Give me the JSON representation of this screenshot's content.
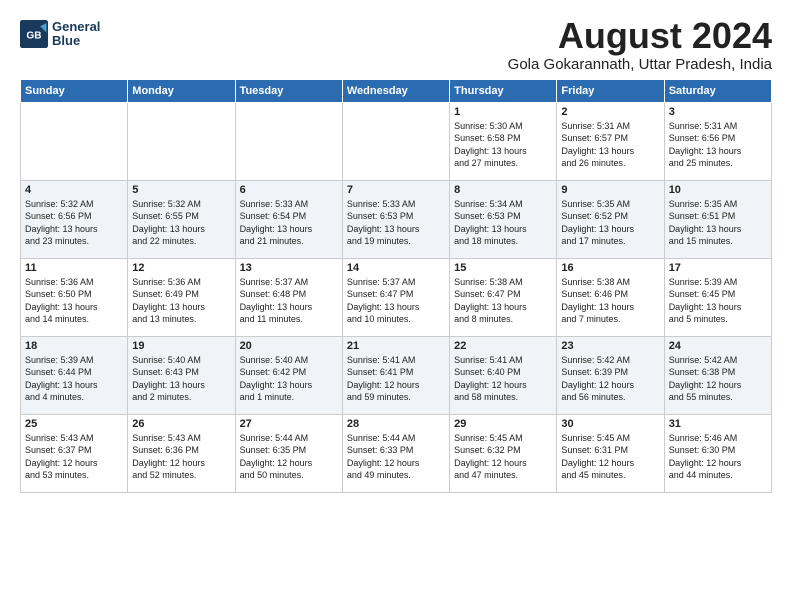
{
  "header": {
    "logo_line1": "General",
    "logo_line2": "Blue",
    "month_title": "August 2024",
    "location": "Gola Gokarannath, Uttar Pradesh, India"
  },
  "weekdays": [
    "Sunday",
    "Monday",
    "Tuesday",
    "Wednesday",
    "Thursday",
    "Friday",
    "Saturday"
  ],
  "weeks": [
    [
      {
        "day": "",
        "info": ""
      },
      {
        "day": "",
        "info": ""
      },
      {
        "day": "",
        "info": ""
      },
      {
        "day": "",
        "info": ""
      },
      {
        "day": "1",
        "info": "Sunrise: 5:30 AM\nSunset: 6:58 PM\nDaylight: 13 hours\nand 27 minutes."
      },
      {
        "day": "2",
        "info": "Sunrise: 5:31 AM\nSunset: 6:57 PM\nDaylight: 13 hours\nand 26 minutes."
      },
      {
        "day": "3",
        "info": "Sunrise: 5:31 AM\nSunset: 6:56 PM\nDaylight: 13 hours\nand 25 minutes."
      }
    ],
    [
      {
        "day": "4",
        "info": "Sunrise: 5:32 AM\nSunset: 6:56 PM\nDaylight: 13 hours\nand 23 minutes."
      },
      {
        "day": "5",
        "info": "Sunrise: 5:32 AM\nSunset: 6:55 PM\nDaylight: 13 hours\nand 22 minutes."
      },
      {
        "day": "6",
        "info": "Sunrise: 5:33 AM\nSunset: 6:54 PM\nDaylight: 13 hours\nand 21 minutes."
      },
      {
        "day": "7",
        "info": "Sunrise: 5:33 AM\nSunset: 6:53 PM\nDaylight: 13 hours\nand 19 minutes."
      },
      {
        "day": "8",
        "info": "Sunrise: 5:34 AM\nSunset: 6:53 PM\nDaylight: 13 hours\nand 18 minutes."
      },
      {
        "day": "9",
        "info": "Sunrise: 5:35 AM\nSunset: 6:52 PM\nDaylight: 13 hours\nand 17 minutes."
      },
      {
        "day": "10",
        "info": "Sunrise: 5:35 AM\nSunset: 6:51 PM\nDaylight: 13 hours\nand 15 minutes."
      }
    ],
    [
      {
        "day": "11",
        "info": "Sunrise: 5:36 AM\nSunset: 6:50 PM\nDaylight: 13 hours\nand 14 minutes."
      },
      {
        "day": "12",
        "info": "Sunrise: 5:36 AM\nSunset: 6:49 PM\nDaylight: 13 hours\nand 13 minutes."
      },
      {
        "day": "13",
        "info": "Sunrise: 5:37 AM\nSunset: 6:48 PM\nDaylight: 13 hours\nand 11 minutes."
      },
      {
        "day": "14",
        "info": "Sunrise: 5:37 AM\nSunset: 6:47 PM\nDaylight: 13 hours\nand 10 minutes."
      },
      {
        "day": "15",
        "info": "Sunrise: 5:38 AM\nSunset: 6:47 PM\nDaylight: 13 hours\nand 8 minutes."
      },
      {
        "day": "16",
        "info": "Sunrise: 5:38 AM\nSunset: 6:46 PM\nDaylight: 13 hours\nand 7 minutes."
      },
      {
        "day": "17",
        "info": "Sunrise: 5:39 AM\nSunset: 6:45 PM\nDaylight: 13 hours\nand 5 minutes."
      }
    ],
    [
      {
        "day": "18",
        "info": "Sunrise: 5:39 AM\nSunset: 6:44 PM\nDaylight: 13 hours\nand 4 minutes."
      },
      {
        "day": "19",
        "info": "Sunrise: 5:40 AM\nSunset: 6:43 PM\nDaylight: 13 hours\nand 2 minutes."
      },
      {
        "day": "20",
        "info": "Sunrise: 5:40 AM\nSunset: 6:42 PM\nDaylight: 13 hours\nand 1 minute."
      },
      {
        "day": "21",
        "info": "Sunrise: 5:41 AM\nSunset: 6:41 PM\nDaylight: 12 hours\nand 59 minutes."
      },
      {
        "day": "22",
        "info": "Sunrise: 5:41 AM\nSunset: 6:40 PM\nDaylight: 12 hours\nand 58 minutes."
      },
      {
        "day": "23",
        "info": "Sunrise: 5:42 AM\nSunset: 6:39 PM\nDaylight: 12 hours\nand 56 minutes."
      },
      {
        "day": "24",
        "info": "Sunrise: 5:42 AM\nSunset: 6:38 PM\nDaylight: 12 hours\nand 55 minutes."
      }
    ],
    [
      {
        "day": "25",
        "info": "Sunrise: 5:43 AM\nSunset: 6:37 PM\nDaylight: 12 hours\nand 53 minutes."
      },
      {
        "day": "26",
        "info": "Sunrise: 5:43 AM\nSunset: 6:36 PM\nDaylight: 12 hours\nand 52 minutes."
      },
      {
        "day": "27",
        "info": "Sunrise: 5:44 AM\nSunset: 6:35 PM\nDaylight: 12 hours\nand 50 minutes."
      },
      {
        "day": "28",
        "info": "Sunrise: 5:44 AM\nSunset: 6:33 PM\nDaylight: 12 hours\nand 49 minutes."
      },
      {
        "day": "29",
        "info": "Sunrise: 5:45 AM\nSunset: 6:32 PM\nDaylight: 12 hours\nand 47 minutes."
      },
      {
        "day": "30",
        "info": "Sunrise: 5:45 AM\nSunset: 6:31 PM\nDaylight: 12 hours\nand 45 minutes."
      },
      {
        "day": "31",
        "info": "Sunrise: 5:46 AM\nSunset: 6:30 PM\nDaylight: 12 hours\nand 44 minutes."
      }
    ]
  ]
}
